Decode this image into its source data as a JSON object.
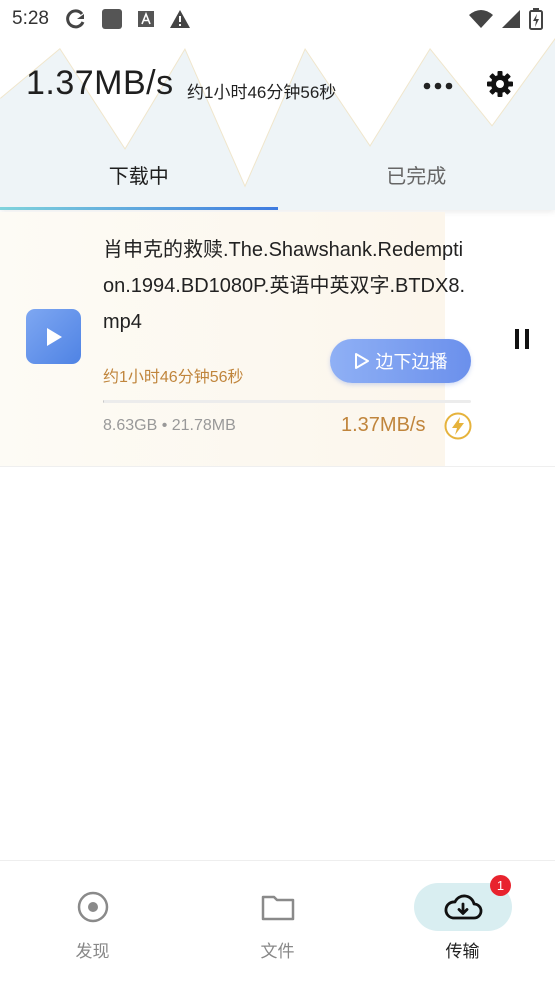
{
  "status_bar": {
    "time": "5:28",
    "left_icons": [
      "sync-icon",
      "app-square-icon",
      "font-a-icon",
      "warning-icon"
    ],
    "right_icons": [
      "wifi-icon",
      "signal-icon",
      "battery-icon"
    ]
  },
  "header": {
    "speed": "1.37MB/s",
    "eta": "约1小时46分钟56秒",
    "more_icon": "more-horizontal-icon",
    "settings_icon": "gear-icon"
  },
  "tabs": [
    {
      "label": "下载中",
      "active": true
    },
    {
      "label": "已完成",
      "active": false
    }
  ],
  "download_item": {
    "file_name": "肖申克的救赎.The.Shawshank.Redemption.1994.BD1080P.英语中英双字.BTDX8.mp4",
    "eta": "约1小时46分钟56秒",
    "stream_button_label": "边下边播",
    "size_info": "8.63GB • 21.78MB",
    "speed": "1.37MB/s",
    "progress": 0.0025,
    "accent_color": "#c0853c"
  },
  "bottom_nav": {
    "items": [
      {
        "label": "发现",
        "icon": "discover-icon",
        "active": false
      },
      {
        "label": "文件",
        "icon": "folder-icon",
        "active": false
      },
      {
        "label": "传输",
        "icon": "cloud-download-icon",
        "active": true
      }
    ],
    "badge": "1"
  }
}
